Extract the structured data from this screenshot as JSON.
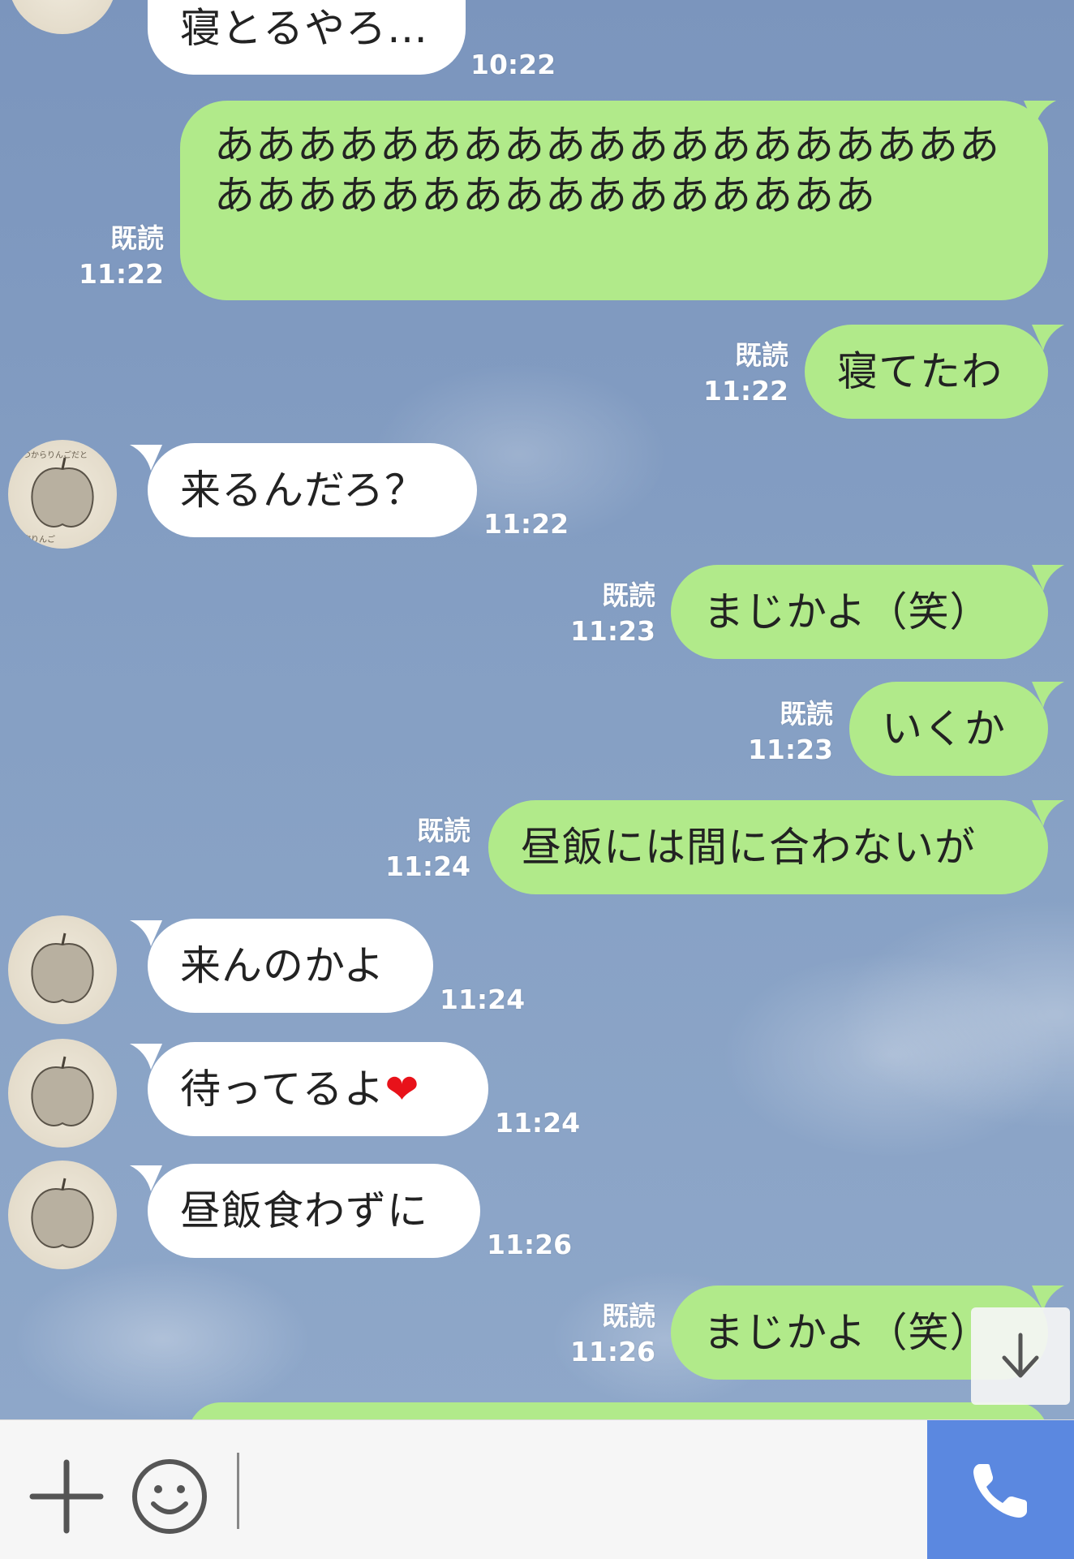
{
  "messages": [
    {
      "side": "in",
      "text": "寝とるやろ…",
      "time": "10:22"
    },
    {
      "side": "out",
      "text": "あああああああああああああああああああああああああああああああああああ",
      "read": "既読",
      "time": "11:22"
    },
    {
      "side": "out",
      "text": "寝てたわ",
      "read": "既読",
      "time": "11:22"
    },
    {
      "side": "in",
      "text": "来るんだろ？",
      "time": "11:22"
    },
    {
      "side": "out",
      "text": "まじかよ（笑）",
      "read": "既読",
      "time": "11:23"
    },
    {
      "side": "out",
      "text": "いくか",
      "read": "既読",
      "time": "11:23"
    },
    {
      "side": "out",
      "text": "昼飯には間に合わないが",
      "read": "既読",
      "time": "11:24"
    },
    {
      "side": "in",
      "text": "来んのかよ",
      "time": "11:24"
    },
    {
      "side": "in",
      "text": "待ってるよ",
      "emoji": "❤",
      "time": "11:24"
    },
    {
      "side": "in",
      "text": "昼飯食わずに",
      "time": "11:26"
    },
    {
      "side": "out",
      "text": "まじかよ（笑）",
      "read": "既読",
      "time": "11:26"
    }
  ],
  "avatar": {
    "label": "いつからりんごだと錯覚していた 自称りんご"
  },
  "input": {
    "placeholder": ""
  },
  "icons": {
    "plus": "plus-icon",
    "emoji": "smiley-icon",
    "call": "phone-icon",
    "scroll": "arrow-down-icon"
  },
  "colors": {
    "incoming_bubble": "#ffffff",
    "outgoing_bubble": "#b1ea8a",
    "call_button": "#5b88e0"
  }
}
